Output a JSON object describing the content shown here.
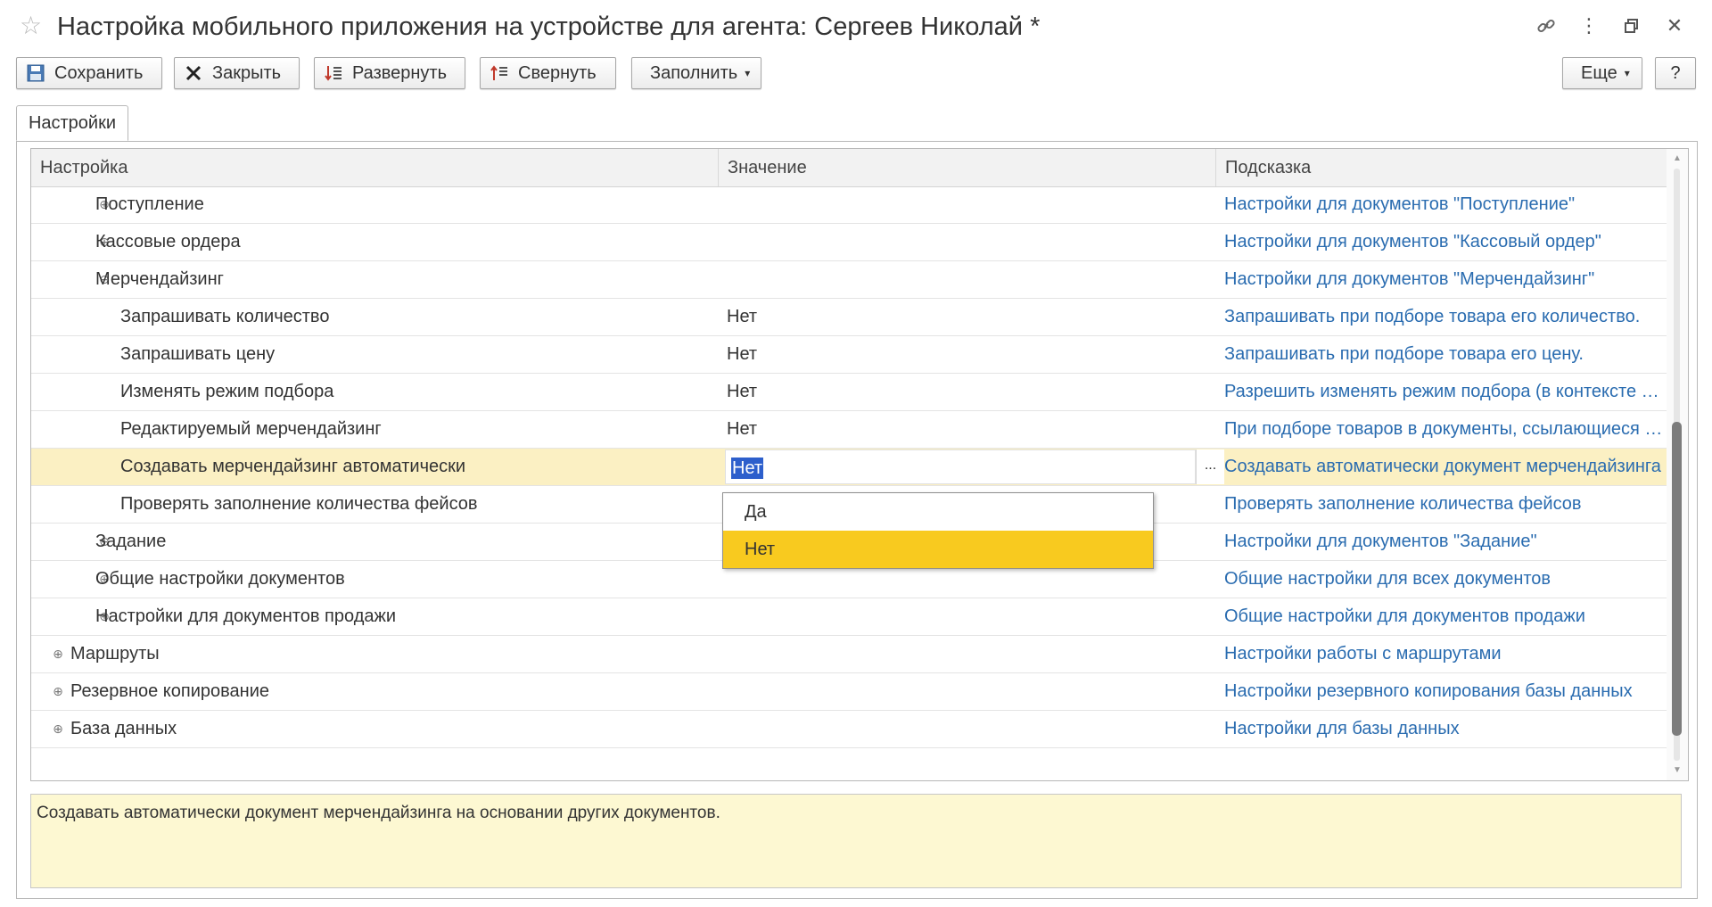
{
  "window": {
    "title": "Настройка мобильного приложения на устройстве для агента: Сергеев Николай *"
  },
  "toolbar": {
    "save": "Сохранить",
    "close": "Закрыть",
    "expand": "Развернуть",
    "collapse": "Свернуть",
    "fill": "Заполнить",
    "more": "Еще",
    "help": "?"
  },
  "tabs": [
    {
      "label": "Настройки"
    }
  ],
  "grid": {
    "columns": [
      "Настройка",
      "Значение",
      "Подсказка"
    ],
    "rows": [
      {
        "name": "Поступление",
        "value": "",
        "hint": "Настройки для документов \"Поступление\"",
        "level": 1,
        "expander": "plus"
      },
      {
        "name": "Кассовые ордера",
        "value": "",
        "hint": "Настройки для документов \"Кассовый ордер\"",
        "level": 1,
        "expander": "plus"
      },
      {
        "name": "Мерчендайзинг",
        "value": "",
        "hint": "Настройки для документов \"Мерчендайзинг\"",
        "level": 1,
        "expander": "minus"
      },
      {
        "name": "Запрашивать количество",
        "value": "Нет",
        "hint": "Запрашивать при подборе товара его количество.",
        "level": 2,
        "expander": ""
      },
      {
        "name": "Запрашивать цену",
        "value": "Нет",
        "hint": "Запрашивать при подборе товара его цену.",
        "level": 2,
        "expander": ""
      },
      {
        "name": "Изменять режим подбора",
        "value": "Нет",
        "hint": "Разрешить изменять режим подбора (в контексте документа)",
        "level": 2,
        "expander": ""
      },
      {
        "name": "Редактируемый мерчендайзинг",
        "value": "Нет",
        "hint": "При подборе товаров в документы, ссылающиеся на мерчендайзинг",
        "level": 2,
        "expander": ""
      },
      {
        "name": "Создавать мерчендайзинг автоматически",
        "value": "Нет",
        "hint": "Создавать автоматически документ мерчендайзинга",
        "level": 2,
        "expander": "",
        "selected": true
      },
      {
        "name": "Проверять заполнение количества фейсов",
        "value": "",
        "hint": "Проверять заполнение количества фейсов",
        "level": 2,
        "expander": ""
      },
      {
        "name": "Задание",
        "value": "",
        "hint": "Настройки для документов \"Задание\"",
        "level": 1,
        "expander": "plus"
      },
      {
        "name": "Общие настройки документов",
        "value": "",
        "hint": "Общие настройки для всех документов",
        "level": 1,
        "expander": "plus"
      },
      {
        "name": "Настройки для документов продажи",
        "value": "",
        "hint": "Общие настройки для документов продажи",
        "level": 1,
        "expander": "plus"
      },
      {
        "name": "Маршруты",
        "value": "",
        "hint": "Настройки работы с маршрутами",
        "level": 0,
        "expander": "plus"
      },
      {
        "name": "Резервное копирование",
        "value": "",
        "hint": "Настройки резервного копирования базы данных",
        "level": 0,
        "expander": "plus"
      },
      {
        "name": "База данных",
        "value": "",
        "hint": "Настройки для базы данных",
        "level": 0,
        "expander": "plus"
      }
    ]
  },
  "dropdown": {
    "options": [
      "Да",
      "Нет"
    ],
    "highlighted": "Нет"
  },
  "description": "Создавать автоматически документ мерчендайзинга на основании других документов.",
  "colors": {
    "hint_link": "#2a6cb0",
    "selected_row": "#fbf0c3",
    "dropdown_highlight": "#f8ca1f",
    "description_bg": "#fdf8d2"
  }
}
